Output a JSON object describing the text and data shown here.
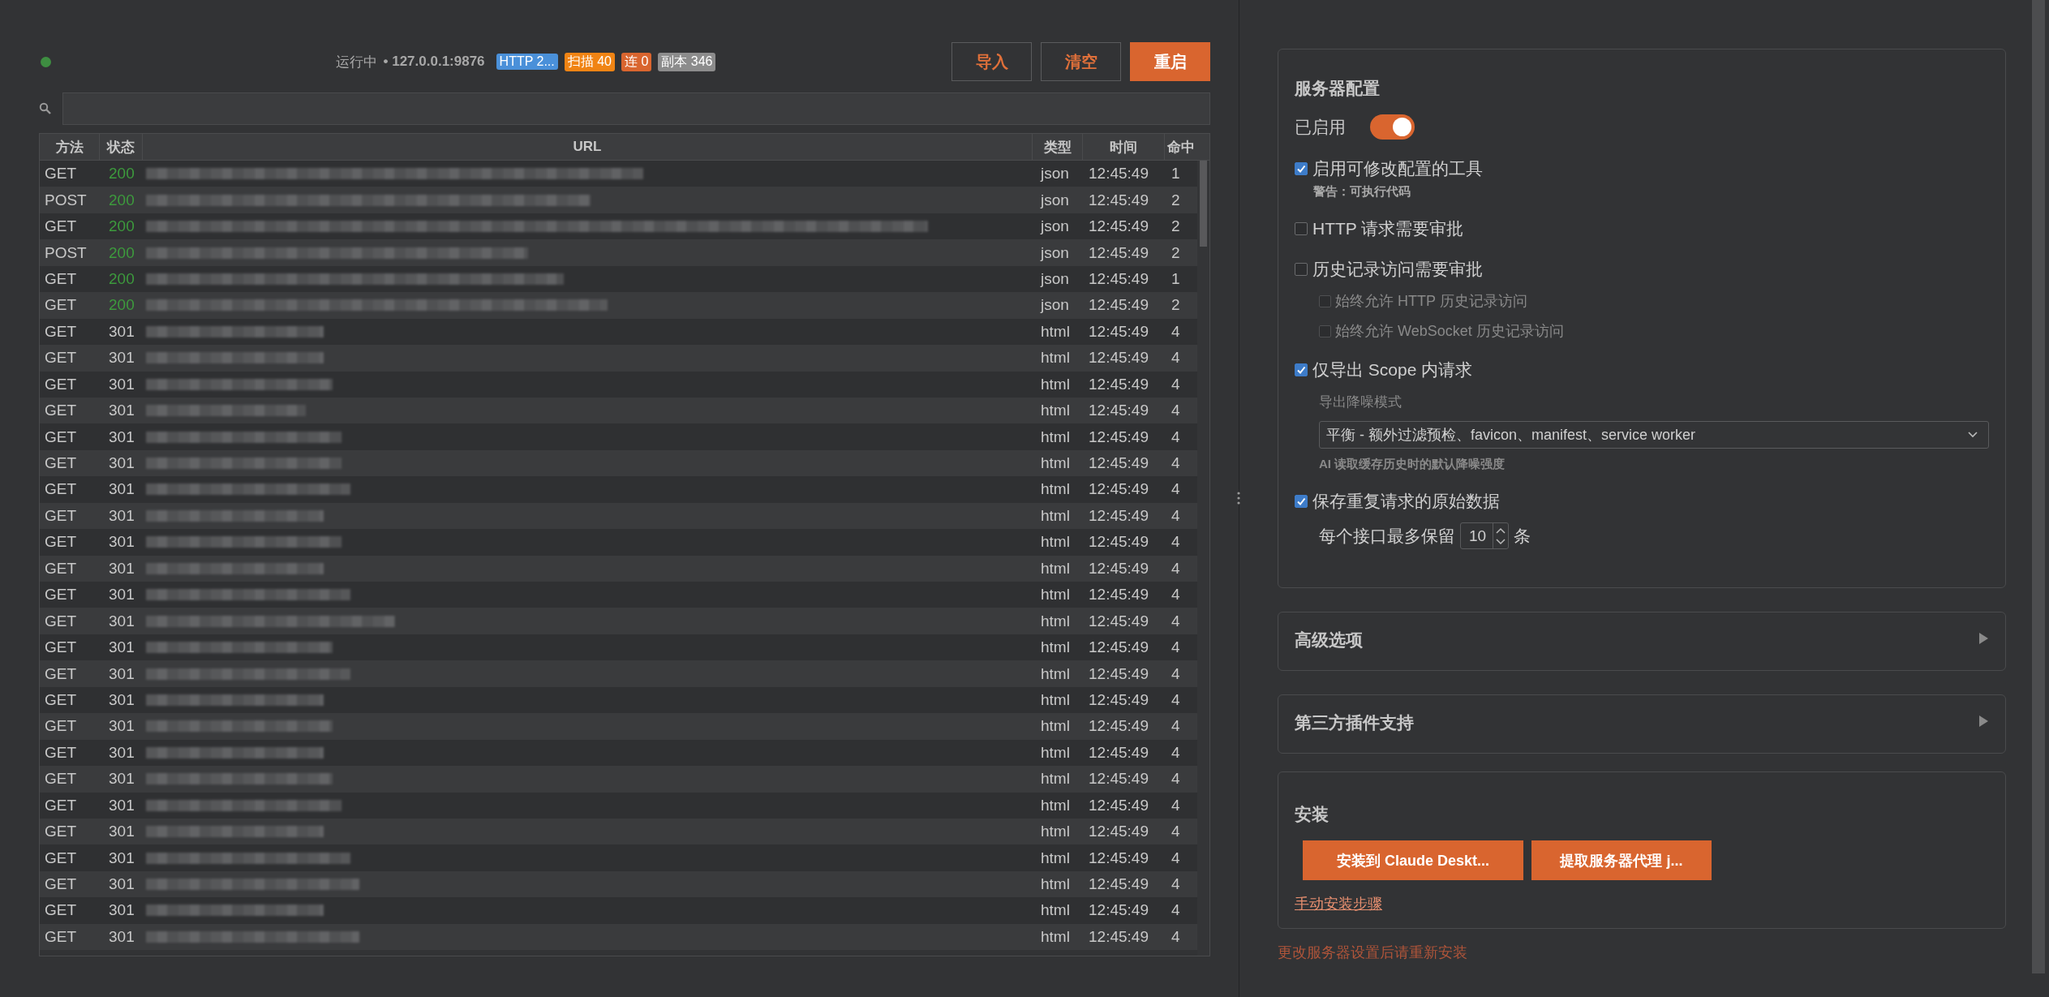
{
  "status": {
    "online": true,
    "label": "运行中",
    "address": "• 127.0.0.1:9876"
  },
  "badges": [
    {
      "text": "HTTP 2...",
      "color": "#4a90d9"
    },
    {
      "text": "扫描 40",
      "color": "#f08414"
    },
    {
      "text": "连 0",
      "color": "#d9652f"
    },
    {
      "text": "副本 346",
      "color": "#8c8c8c"
    }
  ],
  "buttons": [
    {
      "label": "导入",
      "kind": "outline"
    },
    {
      "label": "清空",
      "kind": "outline"
    },
    {
      "label": "重启",
      "kind": "primary"
    }
  ],
  "table": {
    "columns": [
      "方法",
      "状态",
      "URL",
      "类型",
      "时间",
      "命中"
    ],
    "rows": [
      {
        "method": "GET",
        "status": "200",
        "kind": "success",
        "type": "json",
        "time": "12:45:49",
        "hits": "1"
      },
      {
        "method": "POST",
        "status": "200",
        "kind": "success",
        "type": "json",
        "time": "12:45:49",
        "hits": "2"
      },
      {
        "method": "GET",
        "status": "200",
        "kind": "success",
        "type": "json",
        "time": "12:45:49",
        "hits": "2"
      },
      {
        "method": "POST",
        "status": "200",
        "kind": "success",
        "type": "json",
        "time": "12:45:49",
        "hits": "2"
      },
      {
        "method": "GET",
        "status": "200",
        "kind": "success",
        "type": "json",
        "time": "12:45:49",
        "hits": "1"
      },
      {
        "method": "GET",
        "status": "200",
        "kind": "success",
        "type": "json",
        "time": "12:45:49",
        "hits": "2"
      },
      {
        "method": "GET",
        "status": "301",
        "kind": "redirect",
        "type": "html",
        "time": "12:45:49",
        "hits": "4"
      },
      {
        "method": "GET",
        "status": "301",
        "kind": "redirect",
        "type": "html",
        "time": "12:45:49",
        "hits": "4"
      },
      {
        "method": "GET",
        "status": "301",
        "kind": "redirect",
        "type": "html",
        "time": "12:45:49",
        "hits": "4"
      },
      {
        "method": "GET",
        "status": "301",
        "kind": "redirect",
        "type": "html",
        "time": "12:45:49",
        "hits": "4"
      },
      {
        "method": "GET",
        "status": "301",
        "kind": "redirect",
        "type": "html",
        "time": "12:45:49",
        "hits": "4"
      },
      {
        "method": "GET",
        "status": "301",
        "kind": "redirect",
        "type": "html",
        "time": "12:45:49",
        "hits": "4"
      },
      {
        "method": "GET",
        "status": "301",
        "kind": "redirect",
        "type": "html",
        "time": "12:45:49",
        "hits": "4"
      },
      {
        "method": "GET",
        "status": "301",
        "kind": "redirect",
        "type": "html",
        "time": "12:45:49",
        "hits": "4"
      },
      {
        "method": "GET",
        "status": "301",
        "kind": "redirect",
        "type": "html",
        "time": "12:45:49",
        "hits": "4"
      },
      {
        "method": "GET",
        "status": "301",
        "kind": "redirect",
        "type": "html",
        "time": "12:45:49",
        "hits": "4"
      },
      {
        "method": "GET",
        "status": "301",
        "kind": "redirect",
        "type": "html",
        "time": "12:45:49",
        "hits": "4"
      },
      {
        "method": "GET",
        "status": "301",
        "kind": "redirect",
        "type": "html",
        "time": "12:45:49",
        "hits": "4"
      },
      {
        "method": "GET",
        "status": "301",
        "kind": "redirect",
        "type": "html",
        "time": "12:45:49",
        "hits": "4"
      },
      {
        "method": "GET",
        "status": "301",
        "kind": "redirect",
        "type": "html",
        "time": "12:45:49",
        "hits": "4"
      },
      {
        "method": "GET",
        "status": "301",
        "kind": "redirect",
        "type": "html",
        "time": "12:45:49",
        "hits": "4"
      },
      {
        "method": "GET",
        "status": "301",
        "kind": "redirect",
        "type": "html",
        "time": "12:45:49",
        "hits": "4"
      },
      {
        "method": "GET",
        "status": "301",
        "kind": "redirect",
        "type": "html",
        "time": "12:45:49",
        "hits": "4"
      },
      {
        "method": "GET",
        "status": "301",
        "kind": "redirect",
        "type": "html",
        "time": "12:45:49",
        "hits": "4"
      },
      {
        "method": "GET",
        "status": "301",
        "kind": "redirect",
        "type": "html",
        "time": "12:45:49",
        "hits": "4"
      },
      {
        "method": "GET",
        "status": "301",
        "kind": "redirect",
        "type": "html",
        "time": "12:45:49",
        "hits": "4"
      },
      {
        "method": "GET",
        "status": "301",
        "kind": "redirect",
        "type": "html",
        "time": "12:45:49",
        "hits": "4"
      },
      {
        "method": "GET",
        "status": "301",
        "kind": "redirect",
        "type": "html",
        "time": "12:45:49",
        "hits": "4"
      },
      {
        "method": "GET",
        "status": "301",
        "kind": "redirect",
        "type": "html",
        "time": "12:45:49",
        "hits": "4"
      },
      {
        "method": "GET",
        "status": "301",
        "kind": "redirect",
        "type": "html",
        "time": "12:45:49",
        "hits": "4"
      }
    ]
  },
  "server_config": {
    "title": "服务器配置",
    "enabled": {
      "label": "已启用",
      "on": true
    },
    "options": [
      {
        "label": "启用可修改配置的工具",
        "checked": true,
        "note": "警告：可执行代码"
      },
      {
        "label": "HTTP 请求需要审批",
        "checked": false
      },
      {
        "label": "历史记录访问需要审批",
        "checked": false,
        "children": [
          {
            "label": "始终允许 HTTP 历史记录访问",
            "checked": false,
            "disabled": true
          },
          {
            "label": "始终允许 WebSocket 历史记录访问",
            "checked": false,
            "disabled": true
          }
        ]
      },
      {
        "label": "仅导出 Scope 内请求",
        "checked": true,
        "select": {
          "label": "导出降噪模式",
          "value": "平衡 - 额外过滤预检、favicon、manifest、service worker",
          "hint": "AI 读取缓存历史时的默认降噪强度"
        }
      },
      {
        "label": "保存重复请求的原始数据",
        "checked": true,
        "stepper": {
          "label": "每个接口最多保留",
          "value": "10",
          "unit": "条"
        }
      }
    ]
  },
  "sections": [
    {
      "title": "高级选项",
      "expanded": false
    },
    {
      "title": "第三方插件支持",
      "expanded": false
    }
  ],
  "install": {
    "title": "安装",
    "buttons": [
      "安装到 Claude Deskt...",
      "提取服务器代理 j..."
    ],
    "link": "手动安装步骤"
  },
  "footer_note": "更改服务器设置后请重新安装"
}
